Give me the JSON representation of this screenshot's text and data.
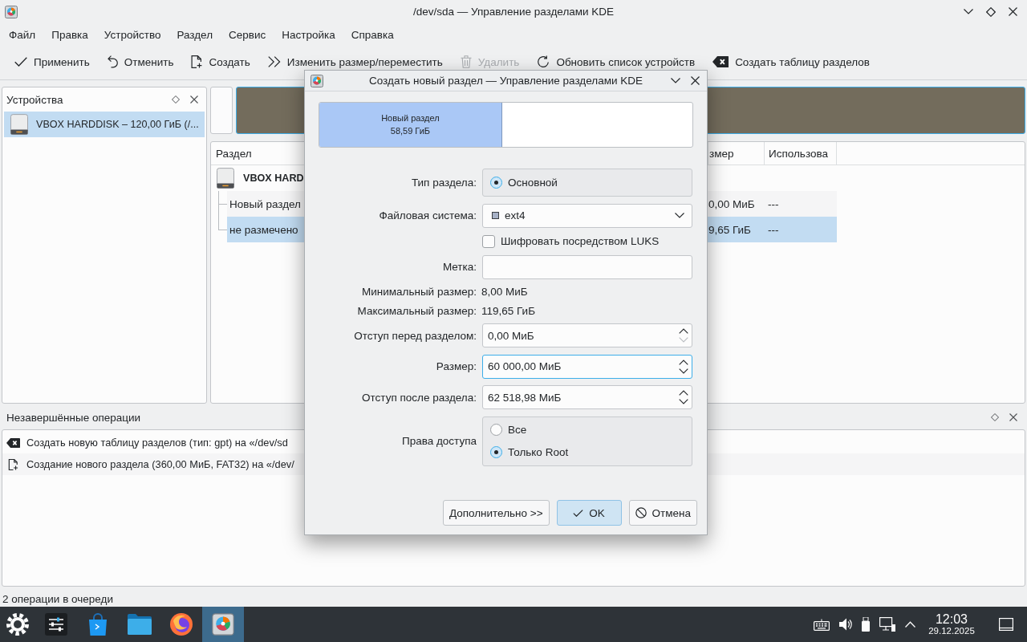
{
  "window": {
    "title": "/dev/sda — Управление разделами KDE"
  },
  "menu": [
    "Файл",
    "Правка",
    "Устройство",
    "Раздел",
    "Сервис",
    "Настройка",
    "Справка"
  ],
  "toolbar": [
    {
      "kind": "apply",
      "label": "Применить",
      "disabled": false
    },
    {
      "kind": "undo",
      "label": "Отменить",
      "disabled": false
    },
    {
      "kind": "new",
      "label": "Создать",
      "disabled": false
    },
    {
      "kind": "resize",
      "label": "Изменить размер/переместить",
      "disabled": false
    },
    {
      "kind": "delete",
      "label": "Удалить",
      "disabled": true
    },
    {
      "kind": "refresh",
      "label": "Обновить список устройств",
      "disabled": false
    },
    {
      "kind": "table",
      "label": "Создать таблицу разделов",
      "disabled": false
    }
  ],
  "devices_panel": {
    "title": "Устройства",
    "items": [
      {
        "label": "VBOX HARDDISK – 120,00 ГиБ (/...",
        "selected": true
      }
    ]
  },
  "partition_table": {
    "columns": [
      "Раздел",
      "змер",
      "Использова"
    ],
    "device": "VBOX HARD",
    "rows": [
      {
        "kind": "partition",
        "name": "Новый раздел",
        "size": "0,00 МиБ",
        "used": "---",
        "selected": false
      },
      {
        "kind": "unallocated",
        "name": "не размечено",
        "size": "9,65 ГиБ",
        "used": "---",
        "selected": true
      }
    ]
  },
  "operations_panel": {
    "title": "Незавершённые операции",
    "items": [
      {
        "kind": "table",
        "text": "Создать новую таблицу разделов (тип: gpt) на «/dev/sd"
      },
      {
        "kind": "new",
        "text": "Создание нового раздела (360,00 МиБ, FAT32) на «/dev/"
      }
    ]
  },
  "status_bar": "2 операции в очереди",
  "dialog": {
    "title": "Создать новый раздел — Управление разделами KDE",
    "partition_preview": {
      "name": "Новый раздел",
      "size": "58,59 ГиБ",
      "level": 0.49
    },
    "form": [
      {
        "kind": "radio_group",
        "label": "Тип раздела:",
        "options": [
          {
            "label": "Основной",
            "selected": true
          }
        ]
      },
      {
        "kind": "dropdown",
        "label": "Файловая система:",
        "value": "ext4"
      },
      {
        "kind": "checkbox",
        "text": "Шифровать посредством LUKS",
        "checked": false
      },
      {
        "kind": "input",
        "label": "Метка:"
      },
      {
        "kind": "info",
        "label": "Минимальный размер:",
        "value": "8,00 МиБ"
      },
      {
        "kind": "info",
        "label": "Максимальный размер:",
        "value": "119,65 ГиБ"
      },
      {
        "kind": "spin",
        "label": "Отступ перед разделом:",
        "value": "0,00 МиБ",
        "focused": false,
        "down_disabled": true
      },
      {
        "kind": "spin",
        "label": "Размер:",
        "value": "60 000,00 МиБ",
        "focused": true,
        "down_disabled": false
      },
      {
        "kind": "spin",
        "label": "Отступ после раздела:",
        "value": "62 518,98 МиБ",
        "focused": false,
        "down_disabled": false
      },
      {
        "kind": "radio_group",
        "label": "Права доступа",
        "options": [
          {
            "label": "Все",
            "selected": false
          },
          {
            "label": "Только Root",
            "selected": true
          }
        ]
      }
    ],
    "buttons": [
      {
        "kind": "details",
        "label": "Дополнительно >>",
        "default": false
      },
      {
        "kind": "ok",
        "label": "OK",
        "default": true
      },
      {
        "kind": "cancel",
        "label": "Отмена",
        "default": false
      }
    ]
  },
  "taskbar": {
    "apps": [
      {
        "kind": "launcher",
        "selected": false
      },
      {
        "kind": "settings",
        "selected": false
      },
      {
        "kind": "store",
        "selected": false
      },
      {
        "kind": "files",
        "selected": false
      },
      {
        "kind": "browser",
        "selected": false
      },
      {
        "kind": "partition_manager",
        "selected": true
      }
    ],
    "tray": [
      {
        "kind": "keyboard"
      },
      {
        "kind": "volume"
      },
      {
        "kind": "usb"
      },
      {
        "kind": "network"
      },
      {
        "kind": "expand"
      }
    ],
    "time": "12:03",
    "date": "29.12.2025"
  }
}
